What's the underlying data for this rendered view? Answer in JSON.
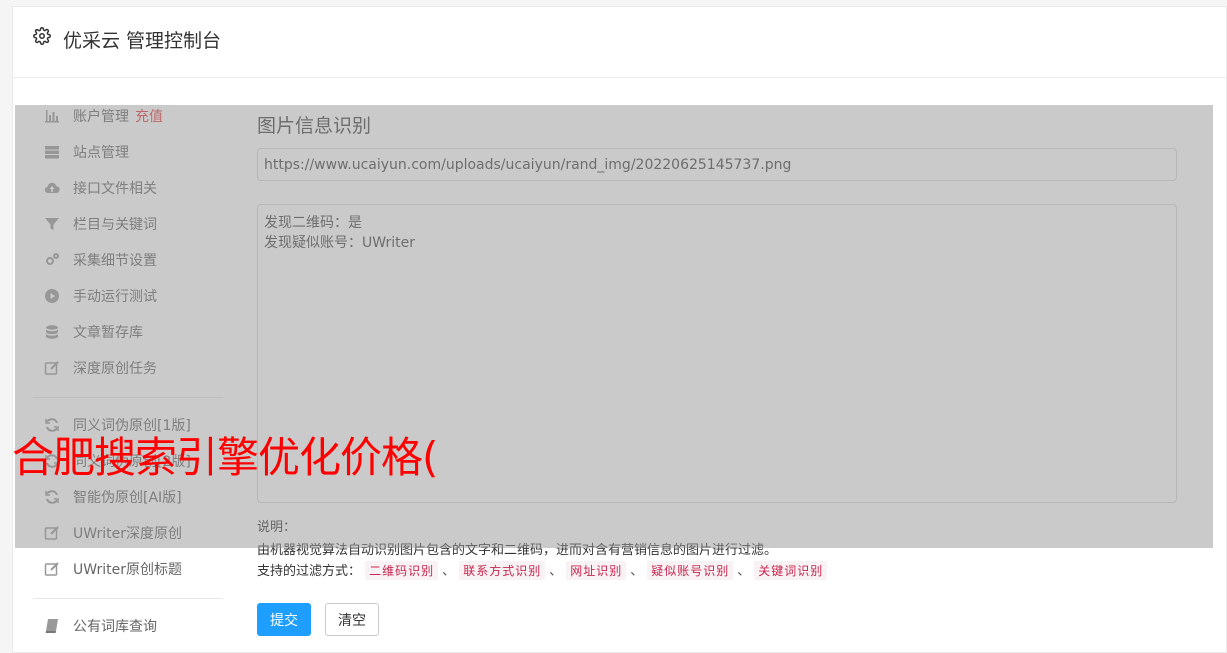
{
  "header": {
    "title": "优采云 管理控制台"
  },
  "sidebar": {
    "recharge_label": "充值",
    "items": [
      {
        "label": "账户管理",
        "icon": "bar-chart-icon"
      },
      {
        "label": "站点管理",
        "icon": "server-icon"
      },
      {
        "label": "接口文件相关",
        "icon": "cloud-upload-icon"
      },
      {
        "label": "栏目与关键词",
        "icon": "filter-icon"
      },
      {
        "label": "采集细节设置",
        "icon": "cogs-icon"
      },
      {
        "label": "手动运行测试",
        "icon": "play-circle-icon"
      },
      {
        "label": "文章暂存库",
        "icon": "database-icon"
      },
      {
        "label": "深度原创任务",
        "icon": "edit-icon"
      },
      {
        "label": "同义词伪原创[1版]",
        "icon": "refresh-icon"
      },
      {
        "label": "同义词伪原创[2版]",
        "icon": "refresh-icon"
      },
      {
        "label": "智能伪原创[AI版]",
        "icon": "refresh-icon"
      },
      {
        "label": "UWriter深度原创",
        "icon": "edit-icon"
      },
      {
        "label": "UWriter原创标题",
        "icon": "edit-icon"
      },
      {
        "label": "公有词库查询",
        "icon": "book-icon"
      }
    ]
  },
  "main": {
    "title": "图片信息识别",
    "url_value": "https://www.ucaiyun.com/uploads/ucaiyun/rand_img/20220625145737.png",
    "result_lines": [
      "发现二维码：是",
      "发现疑似账号：UWriter"
    ],
    "note_label": "说明：",
    "note_text": "由机器视觉算法自动识别图片包含的文字和二维码，进而对含有营销信息的图片进行过滤。",
    "filter_label": "支持的过滤方式：",
    "filter_tags": [
      "二维码识别",
      "联系方式识别",
      "网址识别",
      "疑似账号识别",
      "关键词识别"
    ],
    "filter_sep": "、",
    "submit_label": "提交",
    "clear_label": "清空"
  },
  "overlay": {
    "ad_text": "合肥搜索引擎优化价格("
  },
  "colors": {
    "accent": "#1e9fff",
    "tag_text": "#c7254e",
    "tag_bg": "#f9f2f4",
    "recharge": "#e4393c",
    "ad_text": "#ff0000"
  }
}
